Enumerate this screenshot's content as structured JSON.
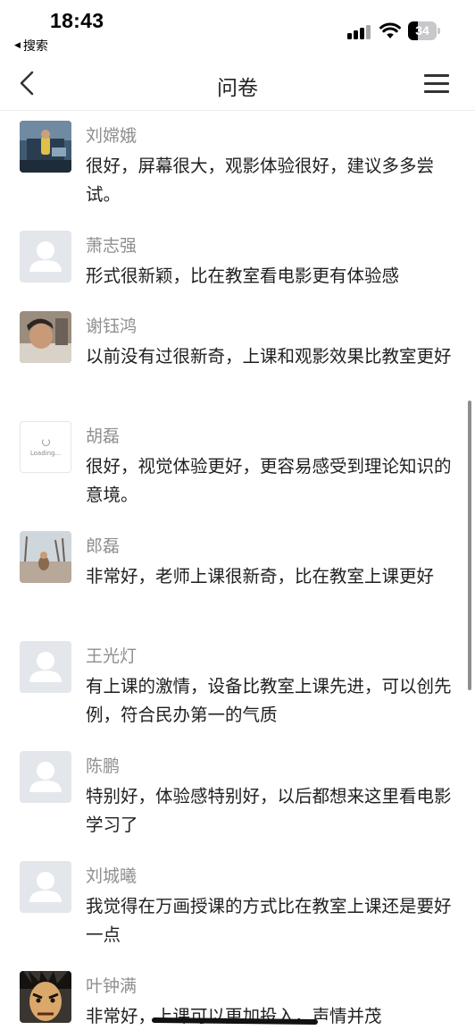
{
  "status_bar": {
    "time": "18:43",
    "back_app_label": "搜索",
    "battery_level": "34",
    "battery_percent": 34,
    "signal_icon": "cellular-signal-icon",
    "wifi_icon": "wifi-icon"
  },
  "nav": {
    "title": "问卷",
    "back_icon": "chevron-left-icon",
    "menu_icon": "hamburger-menu-icon"
  },
  "comments": [
    {
      "name": "刘嫦娥",
      "text": "很好，屏幕很大，观影体验很好，建议多多尝试。",
      "avatar": "photo"
    },
    {
      "name": "萧志强",
      "text": "形式很新颖，比在教室看电影更有体验感",
      "avatar": "placeholder"
    },
    {
      "name": "谢钰鸿",
      "text": "以前没有过很新奇，上课和观影效果比教室更好",
      "avatar": "photo"
    },
    {
      "name": "胡磊",
      "text": "很好，视觉体验更好，更容易感受到理论知识的意境。",
      "avatar": "loading",
      "loading_label": "Loading..."
    },
    {
      "name": "郎磊",
      "text": "非常好，老师上课很新奇，比在教室上课更好",
      "avatar": "photo"
    },
    {
      "name": "王光灯",
      "text": "有上课的激情，设备比教室上课先进，可以创先例，符合民办第一的气质",
      "avatar": "placeholder"
    },
    {
      "name": "陈鹏",
      "text": "特别好，体验感特别好，以后都想来这里看电影学习了",
      "avatar": "placeholder"
    },
    {
      "name": "刘城曦",
      "text": "我觉得在万画授课的方式比在教室上课还是要好一点",
      "avatar": "placeholder"
    },
    {
      "name": "叶钟满",
      "text_before": "非常好，",
      "text_struck": "上课可以更加投入，",
      "text_after": "声情并茂",
      "avatar": "photo"
    }
  ],
  "colors": {
    "name_gray": "#8f8f8f",
    "placeholder_bg": "#e3e6eb",
    "placeholder_fg": "#ffffff"
  }
}
